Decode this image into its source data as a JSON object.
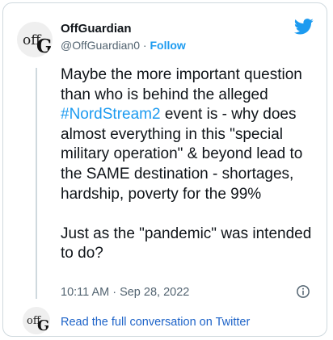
{
  "author": {
    "name": "OffGuardian",
    "handle": "@OffGuardian0",
    "separator": " · ",
    "follow_label": "Follow"
  },
  "tweet": {
    "text_before": "Maybe the more important question than who is behind the alleged ",
    "hashtag": "#NordStream2",
    "text_after": " event is - why does almost everything in this \"special military operation\" & beyond lead to the SAME destination - shortages, hardship, poverty for the 99%\n\nJust as the \"pandemic\" was intended to do?"
  },
  "meta": {
    "timestamp": "10:11 AM · Sep 28, 2022"
  },
  "footer": {
    "read_label": "Read the full conversation on Twitter"
  },
  "colors": {
    "accent": "#1d9bf0",
    "muted": "#536471",
    "link": "#1d63c8"
  },
  "icons": [
    "twitter-bird-icon",
    "info-icon"
  ]
}
